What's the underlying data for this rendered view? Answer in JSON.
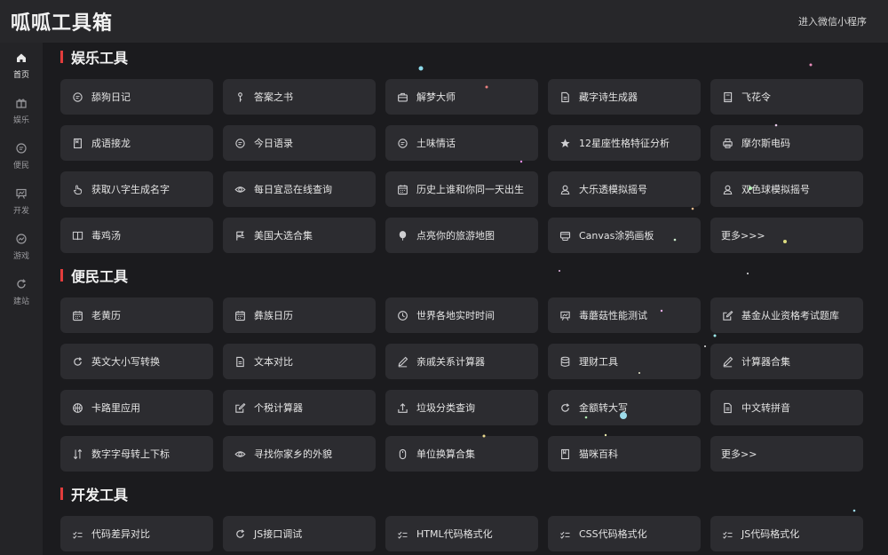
{
  "header": {
    "logo": "呱呱工具箱",
    "mini_program": "进入微信小程序"
  },
  "sidebar": {
    "items": [
      {
        "label": "首页",
        "icon": "home-icon"
      },
      {
        "label": "娱乐",
        "icon": "gift-icon"
      },
      {
        "label": "便民",
        "icon": "chat-icon"
      },
      {
        "label": "开发",
        "icon": "presentation-icon"
      },
      {
        "label": "游戏",
        "icon": "gauge-icon"
      },
      {
        "label": "建站",
        "icon": "refresh-icon"
      }
    ]
  },
  "sections": [
    {
      "title": "娱乐工具",
      "items": [
        {
          "label": "舔狗日记",
          "icon": "chat-icon"
        },
        {
          "label": "答案之书",
          "icon": "key-icon"
        },
        {
          "label": "解梦大师",
          "icon": "briefcase-icon"
        },
        {
          "label": "藏字诗生成器",
          "icon": "document-icon"
        },
        {
          "label": "飞花令",
          "icon": "book-icon"
        },
        {
          "label": "成语接龙",
          "icon": "bookmark-icon"
        },
        {
          "label": "今日语录",
          "icon": "chat-icon"
        },
        {
          "label": "土味情话",
          "icon": "chat-icon"
        },
        {
          "label": "12星座性格特征分析",
          "icon": "star-icon"
        },
        {
          "label": "摩尔斯电码",
          "icon": "printer-icon"
        },
        {
          "label": "获取八字生成名字",
          "icon": "hand-icon"
        },
        {
          "label": "每日宜忌在线查询",
          "icon": "eye-icon"
        },
        {
          "label": "历史上谁和你同一天出生",
          "icon": "calendar-icon"
        },
        {
          "label": "大乐透模拟摇号",
          "icon": "user-icon"
        },
        {
          "label": "双色球模拟摇号",
          "icon": "user-icon"
        },
        {
          "label": "毒鸡汤",
          "icon": "open-book-icon"
        },
        {
          "label": "美国大选合集",
          "icon": "flag-icon"
        },
        {
          "label": "点亮你的旅游地图",
          "icon": "balloon-icon"
        },
        {
          "label": "Canvas涂鸦画板",
          "icon": "canvas-icon"
        },
        {
          "label": "更多>>>",
          "icon": ""
        }
      ]
    },
    {
      "title": "便民工具",
      "items": [
        {
          "label": "老黄历",
          "icon": "calendar-icon"
        },
        {
          "label": "彝族日历",
          "icon": "calendar-icon"
        },
        {
          "label": "世界各地实时时间",
          "icon": "clock-icon"
        },
        {
          "label": "毒蘑菇性能测试",
          "icon": "presentation-icon"
        },
        {
          "label": "基金从业资格考试题库",
          "icon": "edit-icon"
        },
        {
          "label": "英文大小写转换",
          "icon": "refresh-icon"
        },
        {
          "label": "文本对比",
          "icon": "document-icon"
        },
        {
          "label": "亲戚关系计算器",
          "icon": "pen-icon"
        },
        {
          "label": "理财工具",
          "icon": "database-icon"
        },
        {
          "label": "计算器合集",
          "icon": "pen-icon"
        },
        {
          "label": "卡路里应用",
          "icon": "ball-icon"
        },
        {
          "label": "个税计算器",
          "icon": "edit-icon"
        },
        {
          "label": "垃圾分类查询",
          "icon": "upload-icon"
        },
        {
          "label": "金额转大写",
          "icon": "refresh-icon"
        },
        {
          "label": "中文转拼音",
          "icon": "document-icon"
        },
        {
          "label": "数字字母转上下标",
          "icon": "sort-icon"
        },
        {
          "label": "寻找你家乡的外貌",
          "icon": "eye-icon"
        },
        {
          "label": "单位换算合集",
          "icon": "mouse-icon"
        },
        {
          "label": "猫咪百科",
          "icon": "bookmark-icon"
        },
        {
          "label": "更多>>",
          "icon": ""
        }
      ]
    },
    {
      "title": "开发工具",
      "items": [
        {
          "label": "代码差异对比",
          "icon": "checklist-icon"
        },
        {
          "label": "JS接口调试",
          "icon": "refresh-icon"
        },
        {
          "label": "HTML代码格式化",
          "icon": "checklist-icon"
        },
        {
          "label": "CSS代码格式化",
          "icon": "checklist-icon"
        },
        {
          "label": "JS代码格式化",
          "icon": "checklist-icon"
        }
      ]
    }
  ],
  "colors": {
    "background": "#1b1b1e",
    "topbar": "#27272a",
    "sidebar": "#242427",
    "card": "#2c2c30",
    "accent": "#e23c3c",
    "text": "#e4e4e4"
  }
}
